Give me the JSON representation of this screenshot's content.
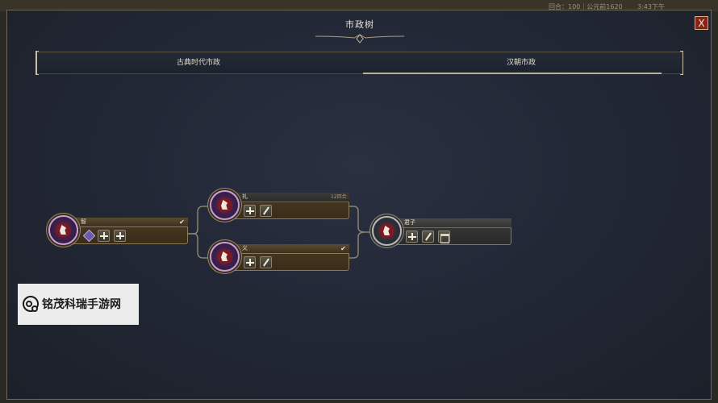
{
  "topbar": {
    "turn_text": "回合：100｜公元前1620",
    "time_text": "3:43下午"
  },
  "window": {
    "title": "市政树",
    "close_label": "X"
  },
  "tabs": [
    {
      "label": "古典时代市政",
      "selected": false
    },
    {
      "label": "汉朝市政",
      "selected": true
    }
  ],
  "nodes": [
    {
      "name": "智",
      "state": "completed",
      "unlocks": [
        "gem-icon",
        "plus-icon",
        "plus-icon"
      ]
    },
    {
      "name": "礼",
      "state": "researching",
      "turns": "12回合",
      "unlocks": [
        "plus-icon",
        "quill-icon"
      ]
    },
    {
      "name": "义",
      "state": "completed",
      "unlocks": [
        "plus-icon",
        "quill-icon"
      ]
    },
    {
      "name": "君子",
      "state": "completed",
      "unlocks": [
        "plus-icon",
        "quill-icon",
        "building-icon"
      ]
    }
  ],
  "watermark": {
    "text": "铭茂科瑞手游网"
  },
  "colors": {
    "panel_bg": "#222836",
    "node_gold": "#8a7a56",
    "node_purple": "#c8a0d8",
    "close_red": "#8a2218"
  }
}
